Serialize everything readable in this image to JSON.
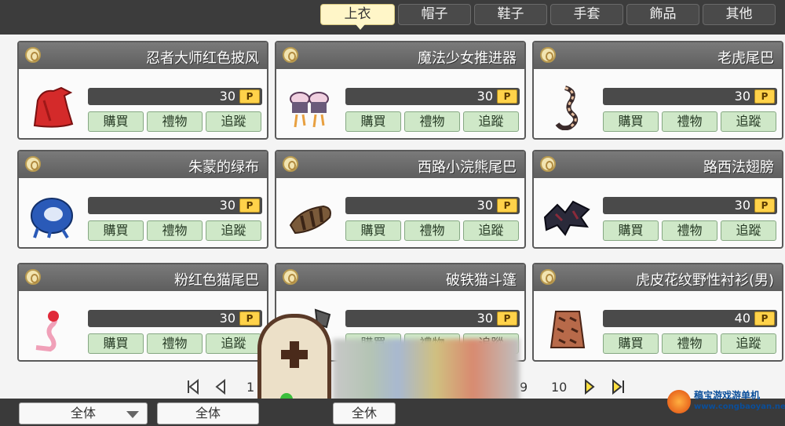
{
  "tabs": [
    {
      "label": "上衣",
      "active": true
    },
    {
      "label": "帽子",
      "active": false
    },
    {
      "label": "鞋子",
      "active": false
    },
    {
      "label": "手套",
      "active": false
    },
    {
      "label": "飾品",
      "active": false
    },
    {
      "label": "其他",
      "active": false
    }
  ],
  "buttons": {
    "buy": "購買",
    "gift": "禮物",
    "track": "追蹤"
  },
  "price_badge": "P",
  "items": [
    {
      "name": "忍者大师红色披风",
      "price": "30",
      "icon": "red-cape-icon"
    },
    {
      "name": "魔法少女推进器",
      "price": "30",
      "icon": "magic-thruster-icon"
    },
    {
      "name": "老虎尾巴",
      "price": "30",
      "icon": "tiger-tail-icon"
    },
    {
      "name": "朱蒙的绿布",
      "price": "30",
      "icon": "blue-cloth-icon"
    },
    {
      "name": "西路小浣熊尾巴",
      "price": "30",
      "icon": "raccoon-tail-icon"
    },
    {
      "name": "路西法翅膀",
      "price": "30",
      "icon": "lucifer-wings-icon"
    },
    {
      "name": "粉红色猫尾巴",
      "price": "30",
      "icon": "pink-cat-tail-icon"
    },
    {
      "name": "破铁猫斗篷",
      "price": "30",
      "icon": "iron-cat-cloak-icon"
    },
    {
      "name": "虎皮花纹野性衬衫(男)",
      "price": "40",
      "icon": "tiger-shirt-icon"
    }
  ],
  "pager": {
    "visible_numbers": [
      "1",
      "9",
      "10"
    ]
  },
  "filters": [
    {
      "label": "全体"
    },
    {
      "label": "全体"
    },
    {
      "label": "全休"
    }
  ],
  "watermark": {
    "title": "稿宝游戏游单机",
    "url": "www.congbaoyan.net"
  }
}
